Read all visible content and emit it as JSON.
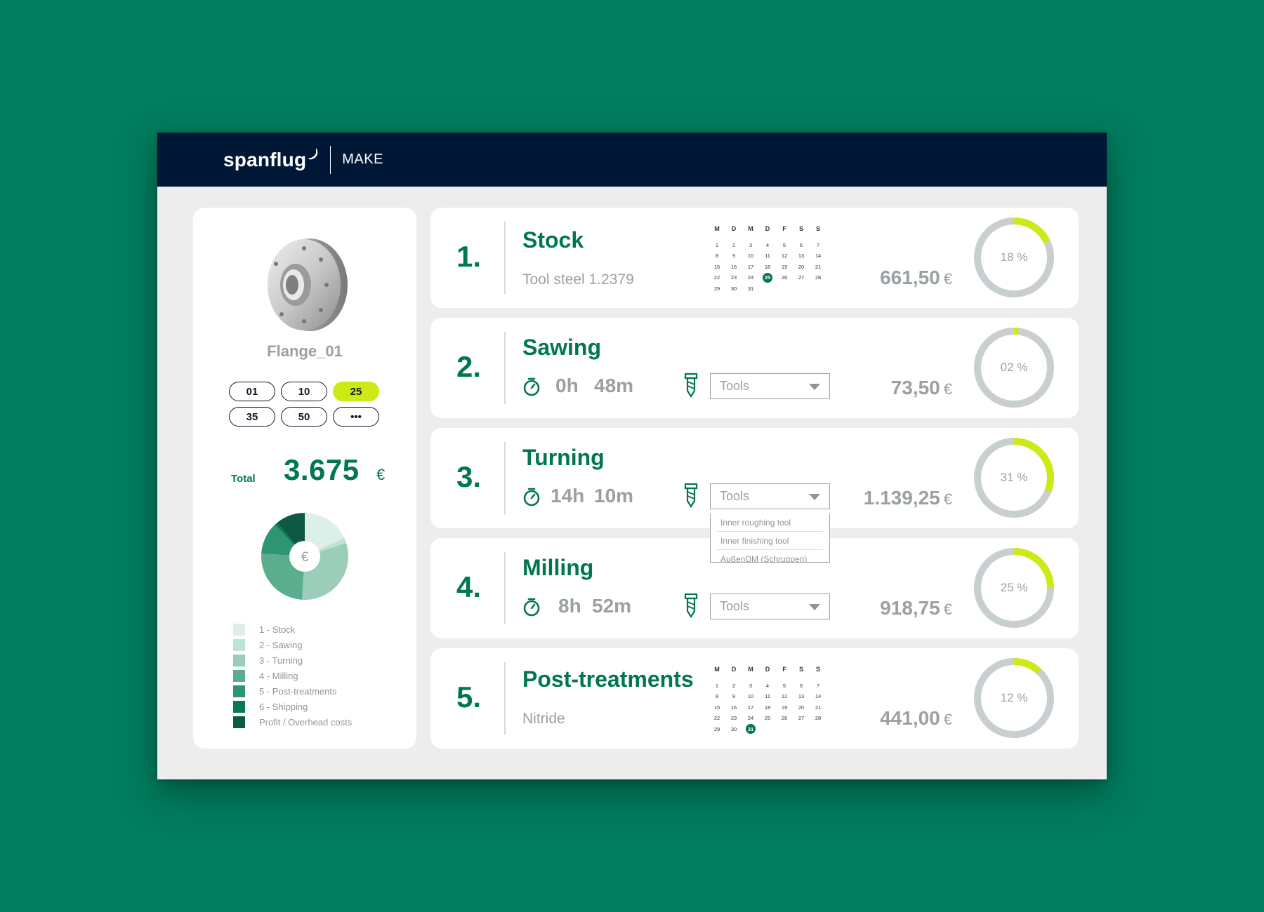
{
  "app": {
    "brand": "spanflug",
    "module": "MAKE"
  },
  "part": {
    "name": "Flange_01"
  },
  "quantities": [
    {
      "label": "01",
      "active": false
    },
    {
      "label": "10",
      "active": false
    },
    {
      "label": "25",
      "active": true
    },
    {
      "label": "35",
      "active": false
    },
    {
      "label": "50",
      "active": false
    },
    {
      "label": "•••",
      "active": false
    }
  ],
  "total": {
    "label": "Total",
    "value": "3.675",
    "currency": "€"
  },
  "cost_chart": {
    "center_symbol": "€",
    "legend": [
      {
        "label": "1 - Stock",
        "color": "#dcefe8"
      },
      {
        "label": "2 - Sawing",
        "color": "#bfe2d4"
      },
      {
        "label": "3 - Turning",
        "color": "#9ccdb9"
      },
      {
        "label": "4 - Milling",
        "color": "#5aae8e"
      },
      {
        "label": "5 - Post-treatments",
        "color": "#2f9472"
      },
      {
        "label": "6 - Shipping",
        "color": "#067a58"
      },
      {
        "label": "Profit / Overhead costs",
        "color": "#0d5a44"
      }
    ],
    "slice_percent": [
      18,
      2,
      31,
      25,
      12,
      1,
      11
    ]
  },
  "steps": [
    {
      "number": "1.",
      "title": "Stock",
      "subtitle": "Tool steel 1.2379",
      "price": "661,50",
      "currency": "€",
      "percent_label": "18 %",
      "percent": 18,
      "calendar": {
        "weekdays": [
          "M",
          "D",
          "M",
          "D",
          "F",
          "S",
          "S"
        ],
        "weeks": [
          [
            "1",
            "2",
            "3",
            "4",
            "5",
            "6",
            "7"
          ],
          [
            "8",
            "9",
            "10",
            "11",
            "12",
            "13",
            "14"
          ],
          [
            "15",
            "16",
            "17",
            "18",
            "19",
            "20",
            "21"
          ],
          [
            "22",
            "23",
            "24",
            "25",
            "26",
            "27",
            "28"
          ],
          [
            "29",
            "30",
            "31",
            "",
            "",
            "",
            ""
          ]
        ],
        "selected": "25"
      }
    },
    {
      "number": "2.",
      "title": "Sawing",
      "time_h": "0h",
      "time_m": "48m",
      "tools_label": "Tools",
      "price": "73,50",
      "currency": "€",
      "percent_label": "02 %",
      "percent": 2
    },
    {
      "number": "3.",
      "title": "Turning",
      "time_h": "14h",
      "time_m": "10m",
      "tools_label": "Tools",
      "tools_options": [
        "Inner roughing tool",
        "Inner finishing tool",
        "AußenDM (Schruppen)"
      ],
      "price": "1.139,25",
      "currency": "€",
      "percent_label": "31 %",
      "percent": 31
    },
    {
      "number": "4.",
      "title": "Milling",
      "time_h": "8h",
      "time_m": "52m",
      "tools_label": "Tools",
      "price": "918,75",
      "currency": "€",
      "percent_label": "25 %",
      "percent": 25
    },
    {
      "number": "5.",
      "title": "Post-treatments",
      "subtitle": "Nitride",
      "price": "441,00",
      "currency": "€",
      "percent_label": "12 %",
      "percent": 12,
      "calendar": {
        "weekdays": [
          "M",
          "D",
          "M",
          "D",
          "F",
          "S",
          "S"
        ],
        "weeks": [
          [
            "1",
            "2",
            "3",
            "4",
            "5",
            "6",
            "7"
          ],
          [
            "8",
            "9",
            "10",
            "11",
            "12",
            "13",
            "14"
          ],
          [
            "15",
            "16",
            "17",
            "18",
            "19",
            "20",
            "21"
          ],
          [
            "22",
            "23",
            "24",
            "25",
            "26",
            "27",
            "28"
          ],
          [
            "29",
            "30",
            "31",
            "",
            "",
            "",
            ""
          ]
        ],
        "selected": "31"
      }
    }
  ],
  "colors": {
    "background": "#007d5e",
    "header": "#001835",
    "brand_green": "#00774f",
    "accent_lime": "#cde916",
    "ring_gray": "#c9ced1",
    "muted_text": "#9aa0a3"
  }
}
